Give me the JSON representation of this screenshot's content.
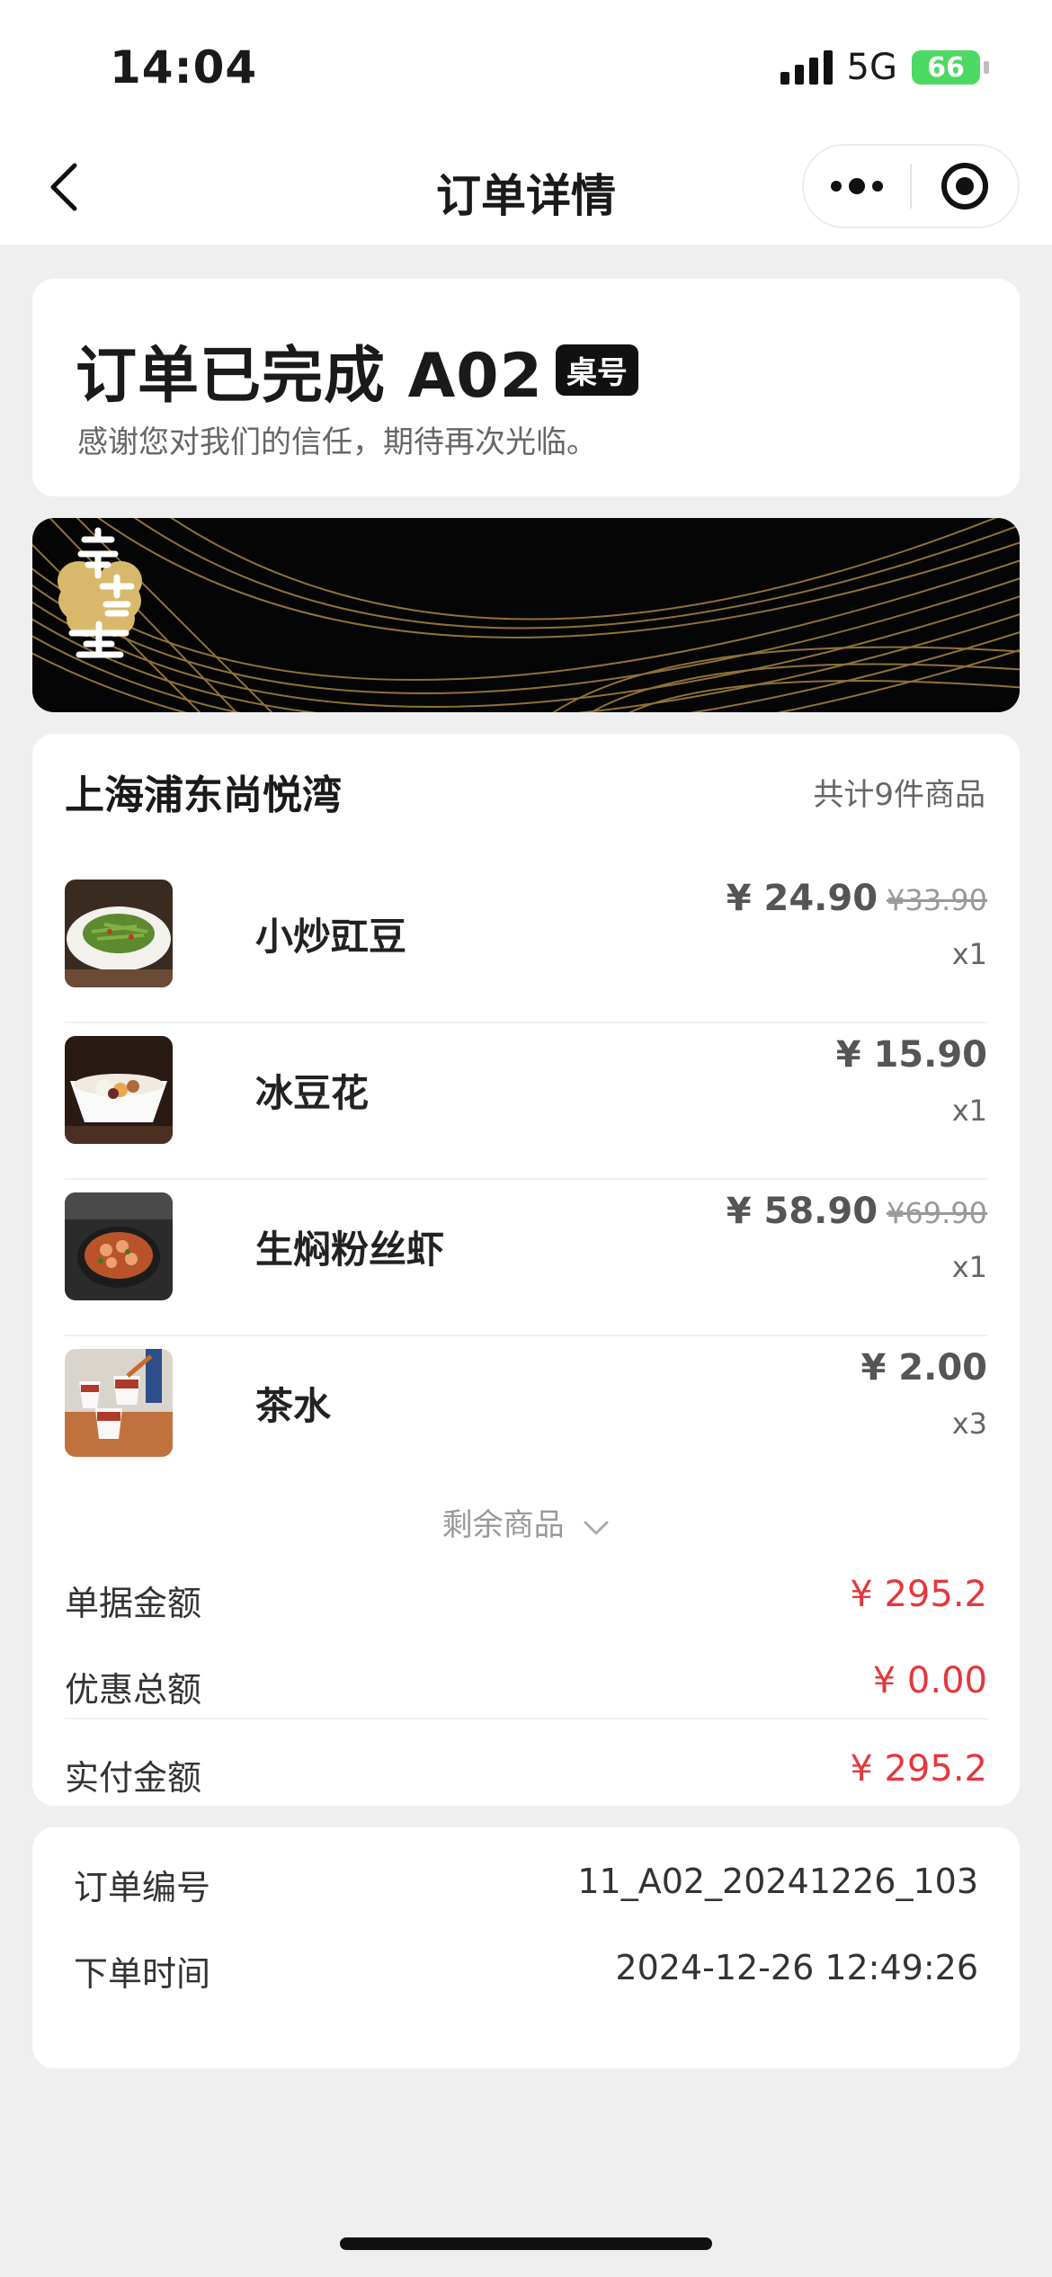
{
  "status_bar": {
    "time": "14:04",
    "network": "5G",
    "battery": "66"
  },
  "nav": {
    "title": "订单详情"
  },
  "order_status": {
    "title": "订单已完成 A02",
    "table_badge": "桌号",
    "subtitle": "感谢您对我们的信任，期待再次光临。"
  },
  "banner": {
    "brand": "辛蓉荟"
  },
  "store": {
    "name": "上海浦东尚悦湾",
    "item_count": "共计9件商品"
  },
  "items": [
    {
      "name": "小炒豇豆",
      "price": "¥ 24.90",
      "original_price": "¥33.90",
      "qty": "x1"
    },
    {
      "name": "冰豆花",
      "price": "¥ 15.90",
      "original_price": "",
      "qty": "x1"
    },
    {
      "name": "生焖粉丝虾",
      "price": "¥ 58.90",
      "original_price": "¥69.90",
      "qty": "x1"
    },
    {
      "name": "茶水",
      "price": "¥ 2.00",
      "original_price": "",
      "qty": "x3"
    }
  ],
  "more_items_label": "剩余商品",
  "summary": {
    "bill_label": "单据金额",
    "bill_value": "¥ 295.2",
    "discount_label": "优惠总额",
    "discount_value": "¥ 0.00",
    "paid_label": "实付金额",
    "paid_value": "¥ 295.2"
  },
  "info": {
    "order_no_label": "订单编号",
    "order_no": "11_A02_20241226_103",
    "time_label": "下单时间",
    "time": "2024-12-26 12:49:26"
  },
  "colors": {
    "accent_red": "#e5373c",
    "banner_gold": "#b08a3e",
    "background": "#efefef"
  },
  "icons": [
    "back-chevron-icon",
    "more-dots-icon",
    "close-target-icon",
    "chevron-down-icon",
    "signal-icon",
    "battery-icon"
  ]
}
